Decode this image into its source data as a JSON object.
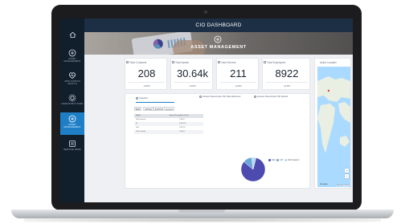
{
  "app": {
    "title": "CIO DASHBOARD"
  },
  "sidebar": {
    "items": [
      {
        "icon": "home-icon",
        "label": ""
      },
      {
        "icon": "asset-management-icon",
        "label": "ASSET MANAGEMENT"
      },
      {
        "icon": "application-health-icon",
        "label": "APPLICATION HEALTH"
      },
      {
        "icon": "infrastructure-icon",
        "label": "INFRASTRUCTURE"
      },
      {
        "icon": "asset-management-active-icon",
        "label": "ASSET MANAGEMENT"
      },
      {
        "icon": "service-desk-icon",
        "label": "SERVICE DESK"
      }
    ]
  },
  "banner": {
    "title": "ASSET MANAGEMENT",
    "icon": "asset-management-icon"
  },
  "kpis": [
    {
      "label": "Total Contracts",
      "value": "208",
      "change": "+9.8%"
    },
    {
      "label": "Total Assets",
      "value": "30.64k",
      "change": "+9.8%"
    },
    {
      "label": "Total Servers",
      "value": "211",
      "change": "+9.8%"
    },
    {
      "label": "Total Employees",
      "value": "8922",
      "change": "+9.8%"
    }
  ],
  "map": {
    "title": "Asset Location",
    "logo": "Google",
    "credit": "Map data ©2017"
  },
  "tabs": [
    {
      "label": "Supplier"
    },
    {
      "label": "Assets Description By Manufacturer"
    },
    {
      "label": "Assets Description By Model"
    }
  ],
  "filters": [
    "Dell",
    "APPLE",
    "EPSON",
    "Lenovo"
  ],
  "table": {
    "headers": [
      "Model",
      "Asset Description Count"
    ],
    "rows": [
      [
        "Dell Inspiron",
        "1,434.7"
      ],
      [
        "M",
        "34,672.6"
      ],
      [
        "Dell",
        "3,213.4"
      ],
      [
        "Dell Latitude",
        "1,434.7"
      ]
    ]
  },
  "chart_data": {
    "type": "pie",
    "categories": [
      "Dell",
      "HP",
      "Dell Inspiron"
    ],
    "values": [
      82,
      12,
      6
    ],
    "colors": [
      "#4d4ab0",
      "#6aa6d6",
      "#b7d6ef"
    ],
    "legend": "right"
  }
}
